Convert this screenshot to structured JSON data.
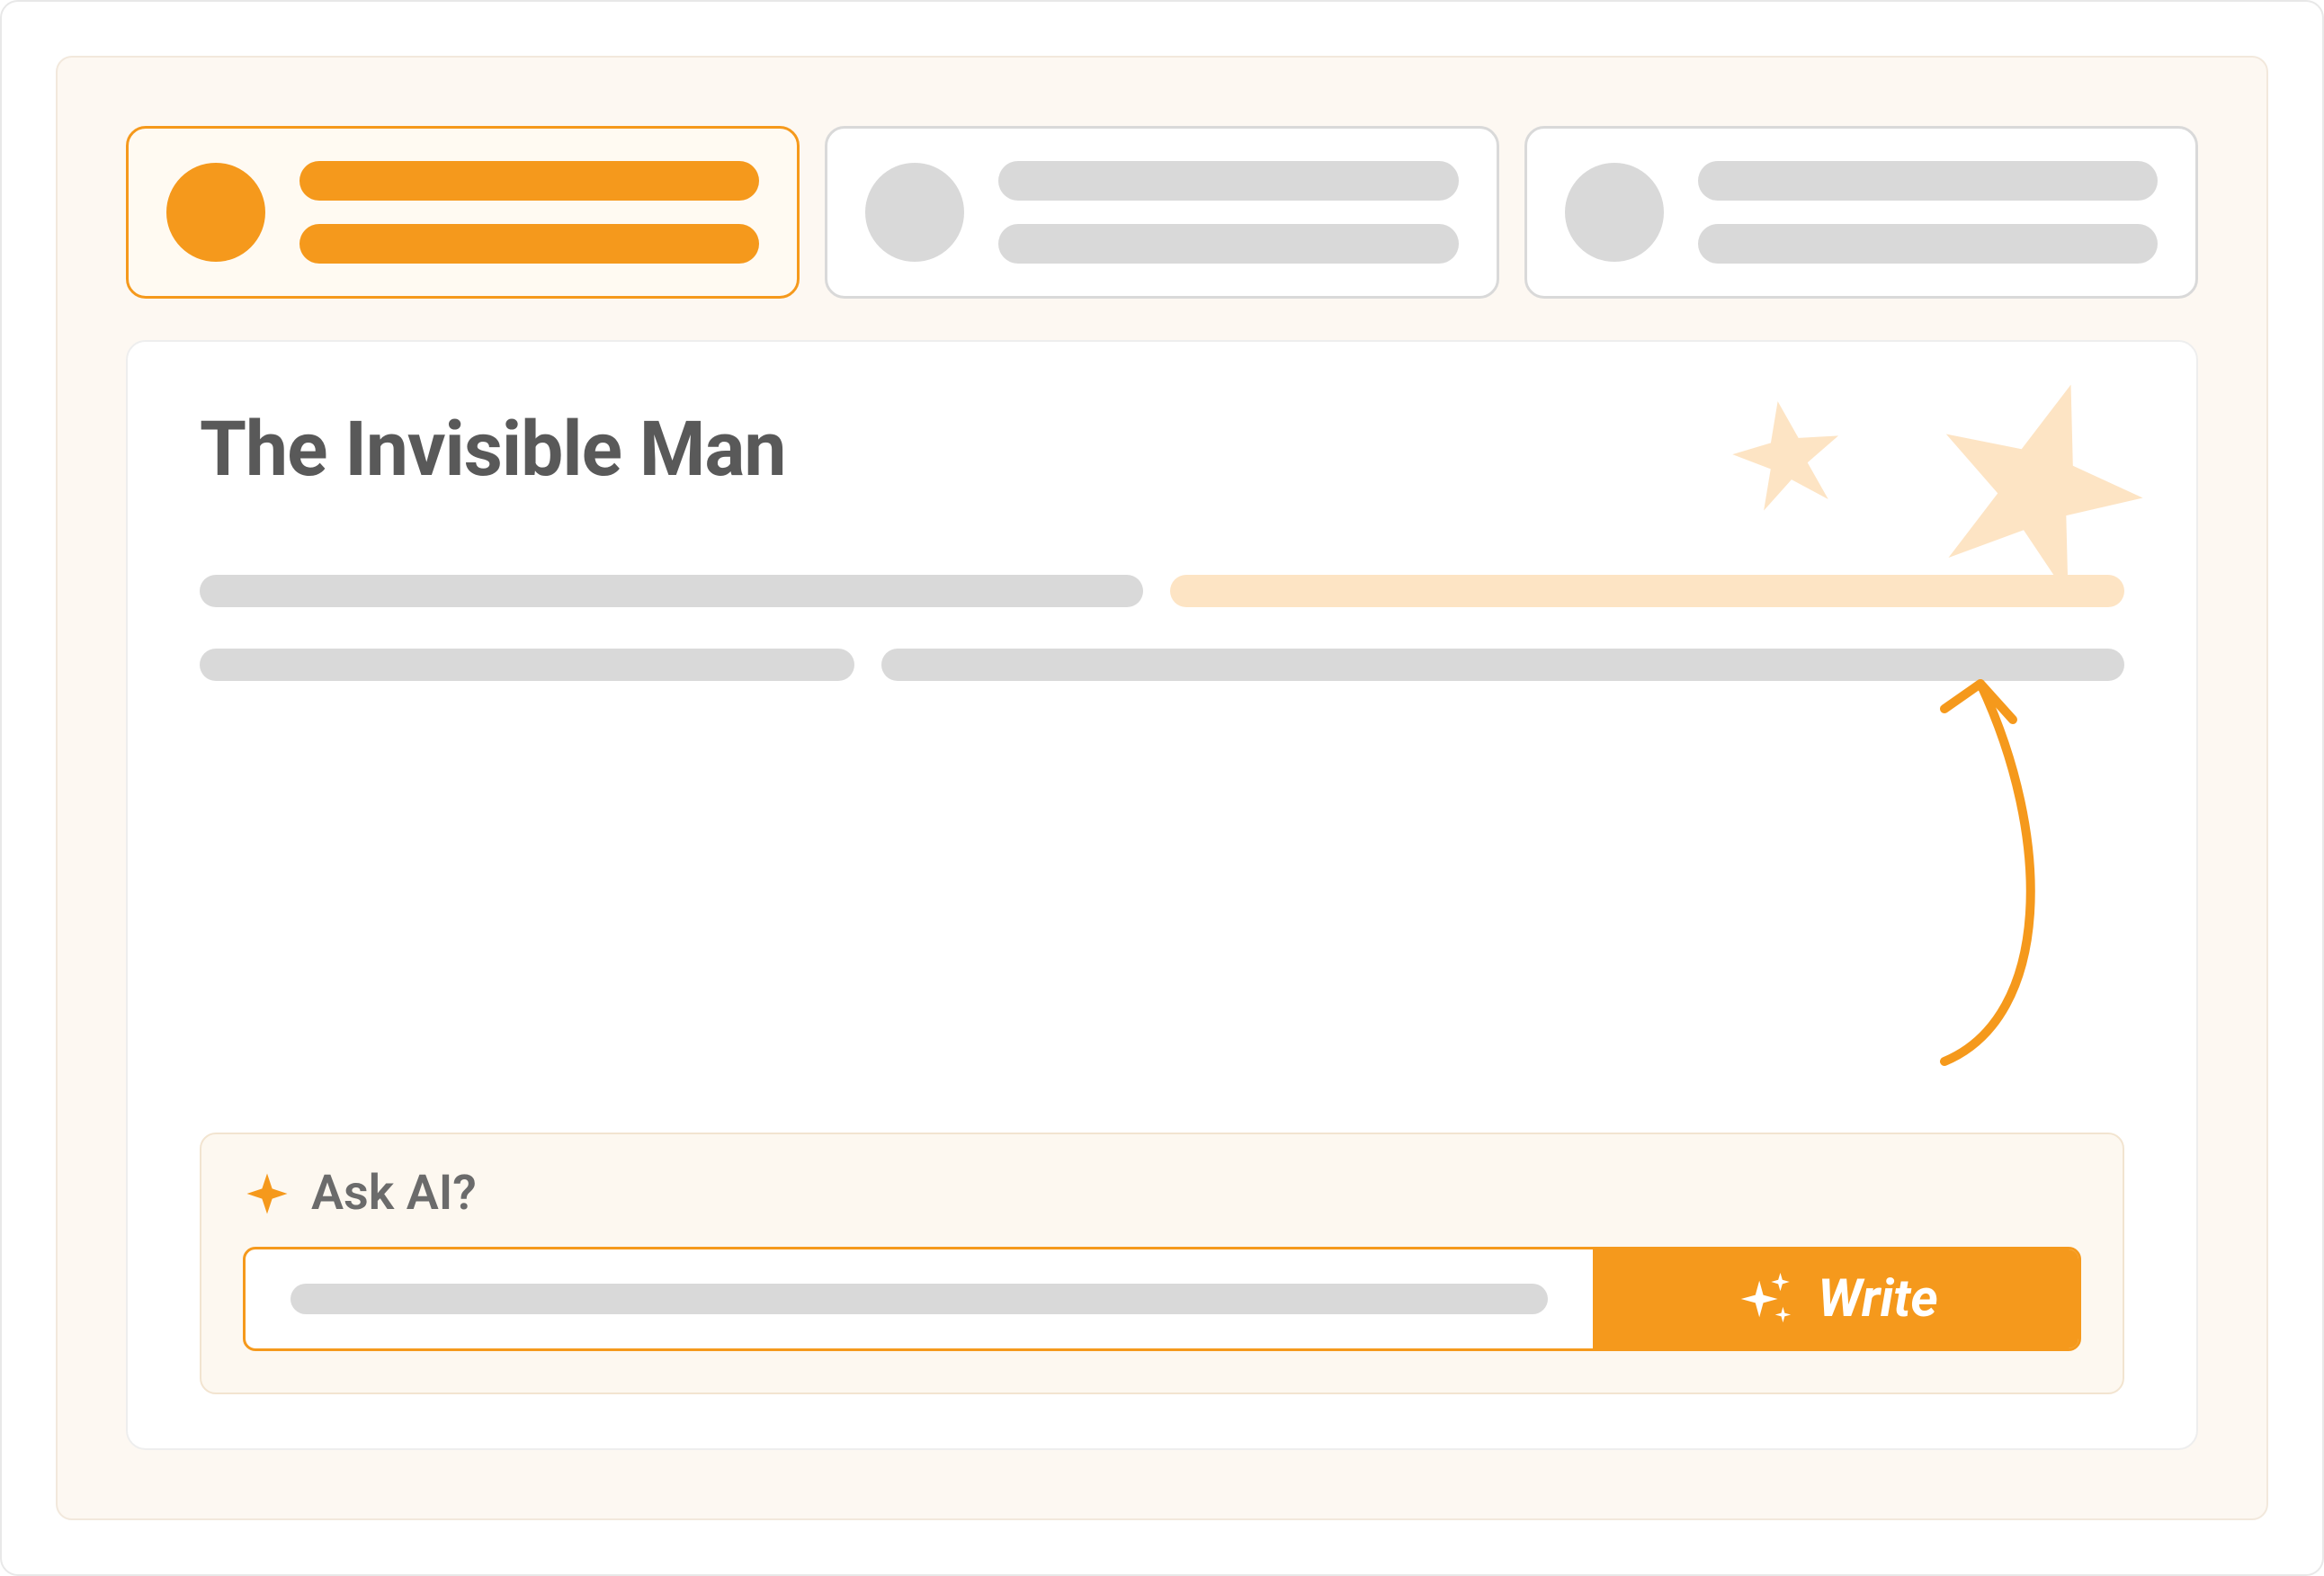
{
  "colors": {
    "accent": "#f5991c",
    "accent_light": "#fde4c4",
    "panel_bg": "#fdf8f0",
    "canvas_bg": "#fdf8f2",
    "skeleton": "#d9d9d9",
    "text_muted": "#595959"
  },
  "tabs": [
    {
      "active": true
    },
    {
      "active": false
    },
    {
      "active": false
    }
  ],
  "content": {
    "title": "The Invisible Man"
  },
  "ai": {
    "label": "Ask AI?",
    "write_button": "Write"
  },
  "icons": {
    "sparkle_small": "sparkle-icon",
    "sparkle_cluster": "sparkles-icon",
    "star_big": "star-icon",
    "star_small": "star-icon"
  }
}
